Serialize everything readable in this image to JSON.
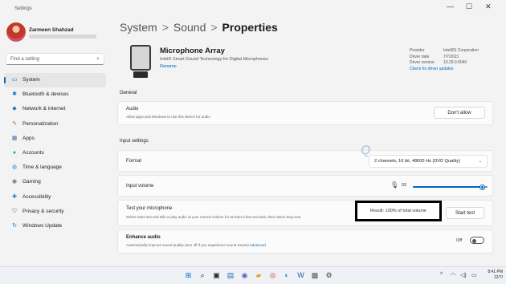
{
  "window": {
    "app_title": "Settings",
    "controls": {
      "minimize": "—",
      "maximize": "☐",
      "close": "✕"
    }
  },
  "profile": {
    "name": "Zarmeen Shahzad"
  },
  "search": {
    "placeholder": "Find a setting",
    "icon": "search-icon"
  },
  "sidebar": {
    "items": [
      {
        "label": "System",
        "icon": "monitor-icon",
        "glyph": "▭",
        "color": "#0067c0",
        "active": true
      },
      {
        "label": "Bluetooth & devices",
        "icon": "bluetooth-icon",
        "glyph": "✱",
        "color": "#0078d4"
      },
      {
        "label": "Network & internet",
        "icon": "network-icon",
        "glyph": "◆",
        "color": "#2f6fb5"
      },
      {
        "label": "Personalization",
        "icon": "brush-icon",
        "glyph": "✎",
        "color": "#c4661a"
      },
      {
        "label": "Apps",
        "icon": "apps-icon",
        "glyph": "▦",
        "color": "#4a6fa5"
      },
      {
        "label": "Accounts",
        "icon": "person-icon",
        "glyph": "●",
        "color": "#2aa876"
      },
      {
        "label": "Time & language",
        "icon": "globe-icon",
        "glyph": "◍",
        "color": "#2b88d8"
      },
      {
        "label": "Gaming",
        "icon": "gamepad-icon",
        "glyph": "◉",
        "color": "#6b6b6b"
      },
      {
        "label": "Accessibility",
        "icon": "accessibility-icon",
        "glyph": "✚",
        "color": "#1f6fc2"
      },
      {
        "label": "Privacy & security",
        "icon": "shield-icon",
        "glyph": "⛉",
        "color": "#6b6b6b"
      },
      {
        "label": "Windows Update",
        "icon": "update-icon",
        "glyph": "↻",
        "color": "#0078d4"
      }
    ]
  },
  "breadcrumb": {
    "part1": "System",
    "part2": "Sound",
    "current": "Properties",
    "separator": ">"
  },
  "device": {
    "name": "Microphone Array",
    "subtitle": "Intel® Smart Sound Technology for Digital Microphones",
    "rename_link": "Rename",
    "info": [
      {
        "label": "Provider",
        "value": "Intel(R) Corporation"
      },
      {
        "label": "Driver date",
        "value": "7/7/2021"
      },
      {
        "label": "Driver version",
        "value": "10.29.0.6040"
      }
    ],
    "driver_link": "Check for driver updates"
  },
  "general": {
    "section_title": "General",
    "audio": {
      "title": "Audio",
      "desc": "Allow apps and Windows to use this device for audio",
      "button": "Don't allow"
    }
  },
  "input_settings": {
    "section_title": "Input settings",
    "format": {
      "title": "Format",
      "value": "2 channels, 16 bit, 48000 Hz (DVD Quality)"
    },
    "volume": {
      "title": "Input volume",
      "value": "93",
      "level_percent": 93
    },
    "test": {
      "title": "Test your microphone",
      "desc": "Select Start test and talk or play audio at your normal volume for at least a few seconds, then select Stop test",
      "result": "Result: 100% of total volume",
      "button": "Start test"
    },
    "enhance": {
      "title": "Enhance audio",
      "desc": "Automatically improve sound quality (turn off if you experience sound issues)",
      "link": "Advanced",
      "state": "Off"
    }
  },
  "watermark": "Q",
  "taskbar": {
    "clock_time": "8:41 PM",
    "clock_date": "12/7/",
    "tray_up": "^",
    "tray_wifi": "◠",
    "tray_speaker": "◁)",
    "tray_battery": "▭",
    "apps": [
      {
        "icon": "windows-start-icon",
        "glyph": "⊞",
        "color": "#0067c0"
      },
      {
        "icon": "search-icon",
        "glyph": "⌕",
        "color": "#222"
      },
      {
        "icon": "task-view-icon",
        "glyph": "▣",
        "color": "#222"
      },
      {
        "icon": "widgets-icon",
        "glyph": "▤",
        "color": "#2b6cc4"
      },
      {
        "icon": "chat-icon",
        "glyph": "◉",
        "color": "#5b5fc7"
      },
      {
        "icon": "file-explorer-icon",
        "glyph": "▰",
        "color": "#e8a617"
      },
      {
        "icon": "chrome-icon",
        "glyph": "◎",
        "color": "#d9453a"
      },
      {
        "icon": "edge-icon",
        "glyph": "◐",
        "color": "#1a8fd0"
      },
      {
        "icon": "word-icon",
        "glyph": "W",
        "color": "#2b579a"
      },
      {
        "icon": "store-icon",
        "glyph": "▩",
        "color": "#555"
      },
      {
        "icon": "settings-icon",
        "glyph": "⚙",
        "color": "#444"
      }
    ]
  }
}
